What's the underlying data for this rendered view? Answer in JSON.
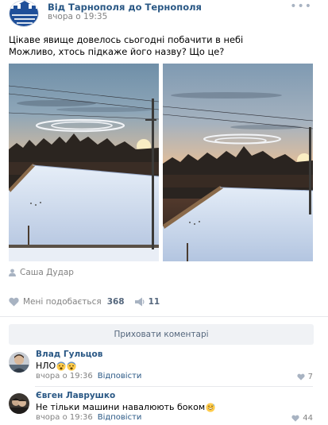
{
  "post": {
    "group_name": "Від Тарнополя до Тернополя",
    "time": "вчора о 19:35",
    "text_lines": [
      "Цікаве явище довелось сьогодні побачити в небі",
      "Можливо, хтось підкаже його назву? Що це?"
    ],
    "photo_author": "Саша Дудар",
    "likes_label": "Мені подобається",
    "likes_count": "368",
    "shares_count": "11",
    "group_logo_text": "Тарнополя до Тернополя"
  },
  "comments_toggle": "Приховати коментарі",
  "comments": [
    {
      "author": "Влад Гульцов",
      "text": "НЛО",
      "time": "вчора о 19:36",
      "reply_label": "Відповісти",
      "likes": "7",
      "emoji": [
        "fearful-face",
        "fearful-face"
      ]
    },
    {
      "author": "Євген Лаврушко",
      "text": "Не тільки машини навалюють боком",
      "time": "вчора о 19:36",
      "reply_label": "Відповісти",
      "likes": "44",
      "emoji": [
        "grinning-face-with-sweat"
      ]
    }
  ],
  "colors": {
    "link_blue": "#2a5885",
    "muted_gray": "#828282",
    "icon_gray": "#a8b3c2",
    "button_bg": "#f0f2f5"
  },
  "icons": [
    "group-logo-icon",
    "more-options-icon",
    "user-icon",
    "heart-icon",
    "share-icon"
  ]
}
